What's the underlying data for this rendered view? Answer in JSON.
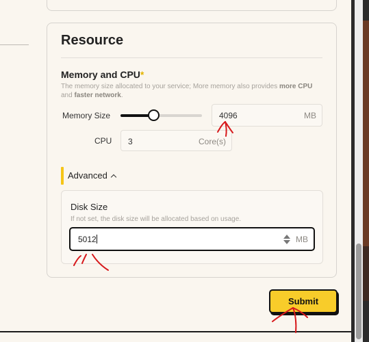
{
  "resource": {
    "title": "Resource",
    "memory_cpu": {
      "title": "Memory and CPU",
      "required_mark": "*",
      "desc_1": "The memory size allocated to your service; More memory also provides ",
      "desc_b1": "more CPU",
      "desc_2": " and ",
      "desc_b2": "faster network",
      "desc_3": ".",
      "memory_label": "Memory Size",
      "memory_value": "4096",
      "memory_unit": "MB",
      "memory_slider_fraction": 0.4,
      "cpu_label": "CPU",
      "cpu_value": "3",
      "cpu_unit": "Core(s)"
    },
    "advanced": {
      "label": "Advanced",
      "disk": {
        "title": "Disk Size",
        "desc": "If not set, the disk size will be allocated based on usage.",
        "value": "5012",
        "unit": "MB"
      }
    }
  },
  "submit_label": "Submit",
  "colors": {
    "accent": "#f5c518",
    "button": "#f8cc2a",
    "annotation": "#d7191c"
  }
}
